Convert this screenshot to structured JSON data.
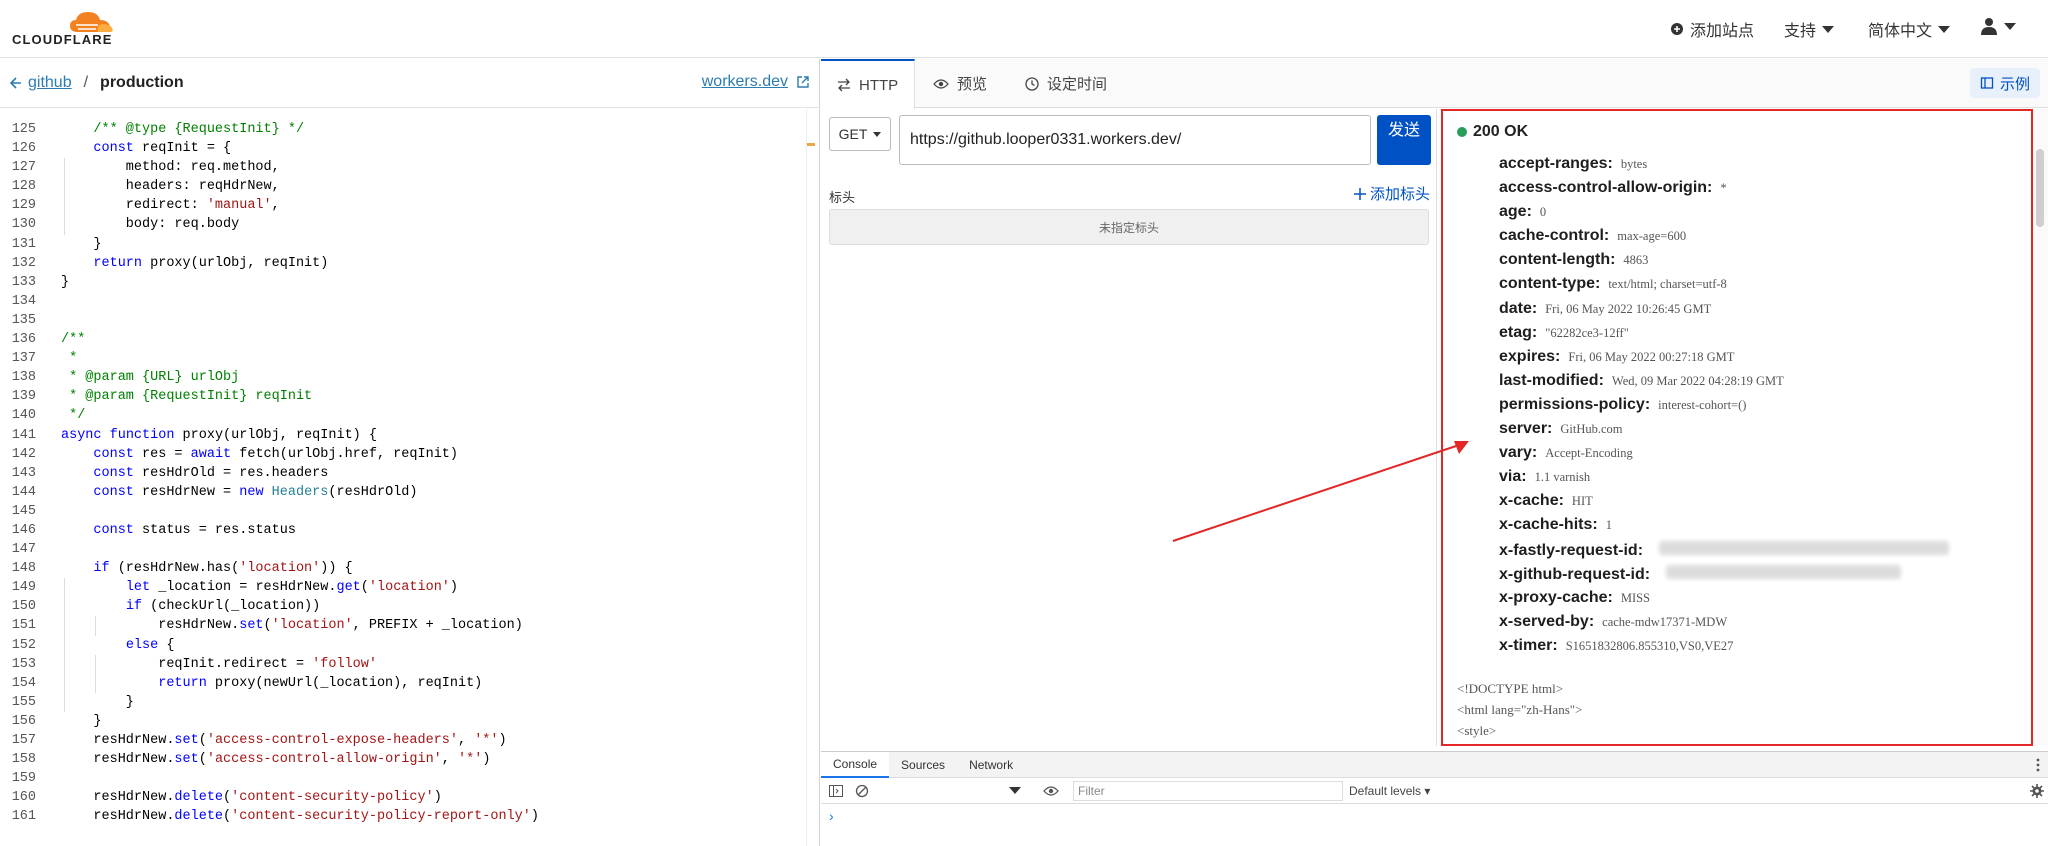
{
  "header": {
    "logo_text": "CLOUDFLARE",
    "nav": [
      {
        "label": "添加站点",
        "icon": "plus-circle-icon"
      },
      {
        "label": "支持",
        "icon": "caret-down-icon"
      },
      {
        "label": "简体中文",
        "icon": "caret-down-icon"
      }
    ],
    "account_icon": "user-icon"
  },
  "breadcrumb": {
    "back": "github",
    "separator": "/",
    "current": "production",
    "workers_link": "workers.dev"
  },
  "editor": {
    "lines": [
      {
        "n": "125",
        "t": "    /** @type {RequestInit} */"
      },
      {
        "n": "126",
        "t": "    const reqInit = {"
      },
      {
        "n": "127",
        "t": "        method: req.method,"
      },
      {
        "n": "128",
        "t": "        headers: reqHdrNew,"
      },
      {
        "n": "129",
        "t": "        redirect: 'manual',"
      },
      {
        "n": "130",
        "t": "        body: req.body"
      },
      {
        "n": "131",
        "t": "    }"
      },
      {
        "n": "132",
        "t": "    return proxy(urlObj, reqInit)"
      },
      {
        "n": "133",
        "t": "}"
      },
      {
        "n": "134",
        "t": ""
      },
      {
        "n": "135",
        "t": ""
      },
      {
        "n": "136",
        "t": "/**"
      },
      {
        "n": "137",
        "t": " *"
      },
      {
        "n": "138",
        "t": " * @param {URL} urlObj"
      },
      {
        "n": "139",
        "t": " * @param {RequestInit} reqInit"
      },
      {
        "n": "140",
        "t": " */"
      },
      {
        "n": "141",
        "t": "async function proxy(urlObj, reqInit) {"
      },
      {
        "n": "142",
        "t": "    const res = await fetch(urlObj.href, reqInit)"
      },
      {
        "n": "143",
        "t": "    const resHdrOld = res.headers"
      },
      {
        "n": "144",
        "t": "    const resHdrNew = new Headers(resHdrOld)"
      },
      {
        "n": "145",
        "t": ""
      },
      {
        "n": "146",
        "t": "    const status = res.status"
      },
      {
        "n": "147",
        "t": ""
      },
      {
        "n": "148",
        "t": "    if (resHdrNew.has('location')) {"
      },
      {
        "n": "149",
        "t": "        let _location = resHdrNew.get('location')"
      },
      {
        "n": "150",
        "t": "        if (checkUrl(_location))"
      },
      {
        "n": "151",
        "t": "            resHdrNew.set('location', PREFIX + _location)"
      },
      {
        "n": "152",
        "t": "        else {"
      },
      {
        "n": "153",
        "t": "            reqInit.redirect = 'follow'"
      },
      {
        "n": "154",
        "t": "            return proxy(newUrl(_location), reqInit)"
      },
      {
        "n": "155",
        "t": "        }"
      },
      {
        "n": "156",
        "t": "    }"
      },
      {
        "n": "157",
        "t": "    resHdrNew.set('access-control-expose-headers', '*')"
      },
      {
        "n": "158",
        "t": "    resHdrNew.set('access-control-allow-origin', '*')"
      },
      {
        "n": "159",
        "t": ""
      },
      {
        "n": "160",
        "t": "    resHdrNew.delete('content-security-policy')"
      },
      {
        "n": "161",
        "t": "    resHdrNew.delete('content-security-policy-report-only')"
      }
    ]
  },
  "tabs": [
    {
      "label": "HTTP",
      "icon": "arrows-exchange-icon"
    },
    {
      "label": "预览",
      "icon": "eye-icon"
    },
    {
      "label": "设定时间",
      "icon": "clock-icon"
    }
  ],
  "example_label": "示例",
  "request": {
    "method": "GET",
    "url": "https://github.looper0331.workers.dev/",
    "send_label": "发送",
    "headers_label": "标头",
    "add_header_label": "添加标头",
    "no_headers": "未指定标头"
  },
  "response": {
    "status": "200 OK",
    "headers": [
      {
        "key": "accept-ranges:",
        "value": "bytes"
      },
      {
        "key": "access-control-allow-origin:",
        "value": "*"
      },
      {
        "key": "age:",
        "value": "0"
      },
      {
        "key": "cache-control:",
        "value": "max-age=600"
      },
      {
        "key": "content-length:",
        "value": "4863"
      },
      {
        "key": "content-type:",
        "value": "text/html; charset=utf-8"
      },
      {
        "key": "date:",
        "value": "Fri, 06 May 2022 10:26:45 GMT"
      },
      {
        "key": "etag:",
        "value": "\"62282ce3-12ff\""
      },
      {
        "key": "expires:",
        "value": "Fri, 06 May 2022 00:27:18 GMT"
      },
      {
        "key": "last-modified:",
        "value": "Wed, 09 Mar 2022 04:28:19 GMT"
      },
      {
        "key": "permissions-policy:",
        "value": "interest-cohort=()"
      },
      {
        "key": "server:",
        "value": "GitHub.com"
      },
      {
        "key": "vary:",
        "value": "Accept-Encoding"
      },
      {
        "key": "via:",
        "value": "1.1 varnish"
      },
      {
        "key": "x-cache:",
        "value": "HIT"
      },
      {
        "key": "x-cache-hits:",
        "value": "1"
      },
      {
        "key": "x-fastly-request-id:",
        "value": ""
      },
      {
        "key": "x-github-request-id:",
        "value": ""
      },
      {
        "key": "x-proxy-cache:",
        "value": "MISS"
      },
      {
        "key": "x-served-by:",
        "value": "cache-mdw17371-MDW"
      },
      {
        "key": "x-timer:",
        "value": "S1651832806.855310,VS0,VE27"
      }
    ],
    "body_lines": [
      "<!DOCTYPE html>",
      "<html lang=\"zh-Hans\">",
      "<style>"
    ]
  },
  "console": {
    "tabs": [
      "Console",
      "Sources",
      "Network"
    ],
    "filter_placeholder": "Filter",
    "levels": "Default levels ▾",
    "prompt": "›"
  },
  "colors": {
    "accent": "#0051c3",
    "highlight_border": "#e32626",
    "status_ok": "#2a9d5b",
    "logo_orange": "#f48120"
  }
}
